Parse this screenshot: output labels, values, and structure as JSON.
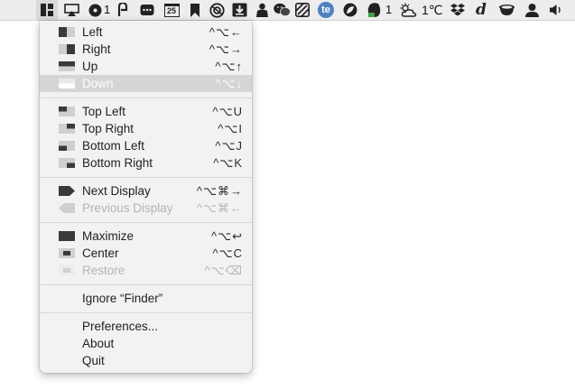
{
  "menubar": {
    "count_a": "1",
    "count_b": "1",
    "calendar_day": "25",
    "temperature": "1℃",
    "dict_letter": "d"
  },
  "menu": {
    "left": {
      "label": "Left",
      "shortcut": "^⌥←"
    },
    "right": {
      "label": "Right",
      "shortcut": "^⌥→"
    },
    "up": {
      "label": "Up",
      "shortcut": "^⌥↑"
    },
    "down": {
      "label": "Down",
      "shortcut": "^⌥↓"
    },
    "top_left": {
      "label": "Top Left",
      "shortcut": "^⌥U"
    },
    "top_right": {
      "label": "Top Right",
      "shortcut": "^⌥I"
    },
    "bottom_left": {
      "label": "Bottom Left",
      "shortcut": "^⌥J"
    },
    "bottom_right": {
      "label": "Bottom Right",
      "shortcut": "^⌥K"
    },
    "next_display": {
      "label": "Next Display",
      "shortcut": "^⌥⌘→"
    },
    "previous_display": {
      "label": "Previous Display",
      "shortcut": "^⌥⌘←"
    },
    "maximize": {
      "label": "Maximize",
      "shortcut": "^⌥↩"
    },
    "center": {
      "label": "Center",
      "shortcut": "^⌥C"
    },
    "restore": {
      "label": "Restore",
      "shortcut": "^⌥⌫"
    },
    "ignore": {
      "label": "Ignore “Finder”"
    },
    "preferences": {
      "label": "Preferences..."
    },
    "about": {
      "label": "About"
    },
    "quit": {
      "label": "Quit"
    }
  }
}
